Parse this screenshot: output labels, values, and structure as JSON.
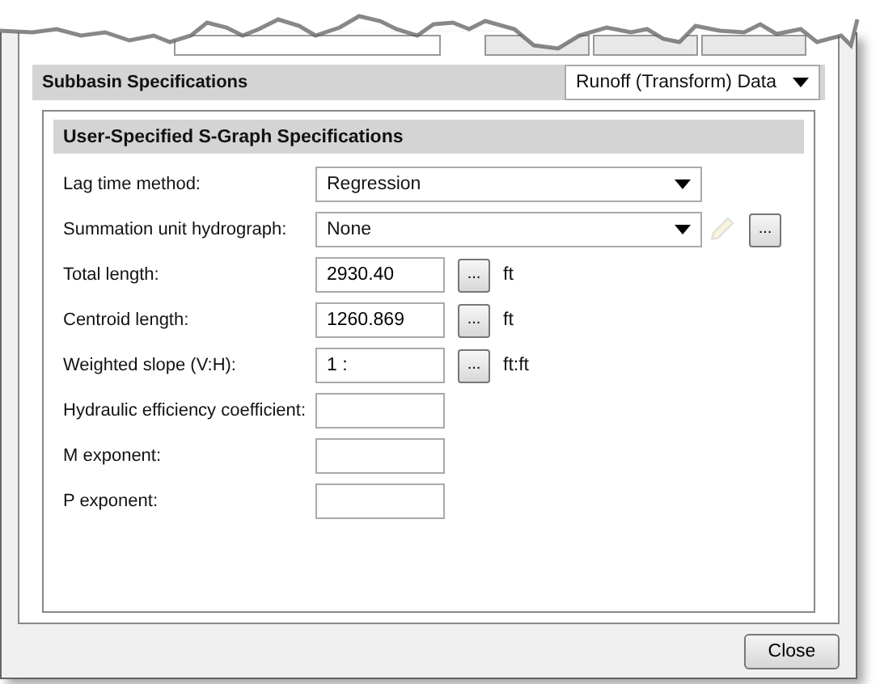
{
  "section": {
    "title": "Subbasin Specifications",
    "dropdown": "Runoff (Transform) Data"
  },
  "group": {
    "title": "User-Specified S-Graph Specifications",
    "rows": [
      {
        "kind": "select",
        "label": "Lag time method:",
        "value": "Regression"
      },
      {
        "kind": "select_with_buttons",
        "label": "Summation unit hydrograph:",
        "value": "None",
        "button": "..."
      },
      {
        "kind": "input_with_button",
        "label": "Total length:",
        "value": "2930.40",
        "button": "...",
        "unit": "ft"
      },
      {
        "kind": "input_with_button",
        "label": "Centroid length:",
        "value": "1260.869",
        "button": "...",
        "unit": "ft"
      },
      {
        "kind": "input_with_button",
        "label": "Weighted slope (V:H):",
        "value": "1 :",
        "button": "...",
        "unit": "ft:ft"
      },
      {
        "kind": "input",
        "label": "Hydraulic efficiency coefficient:"
      },
      {
        "kind": "input",
        "label": "M exponent:"
      },
      {
        "kind": "input",
        "label": "P exponent:"
      }
    ]
  },
  "buttons": [
    "Close"
  ]
}
